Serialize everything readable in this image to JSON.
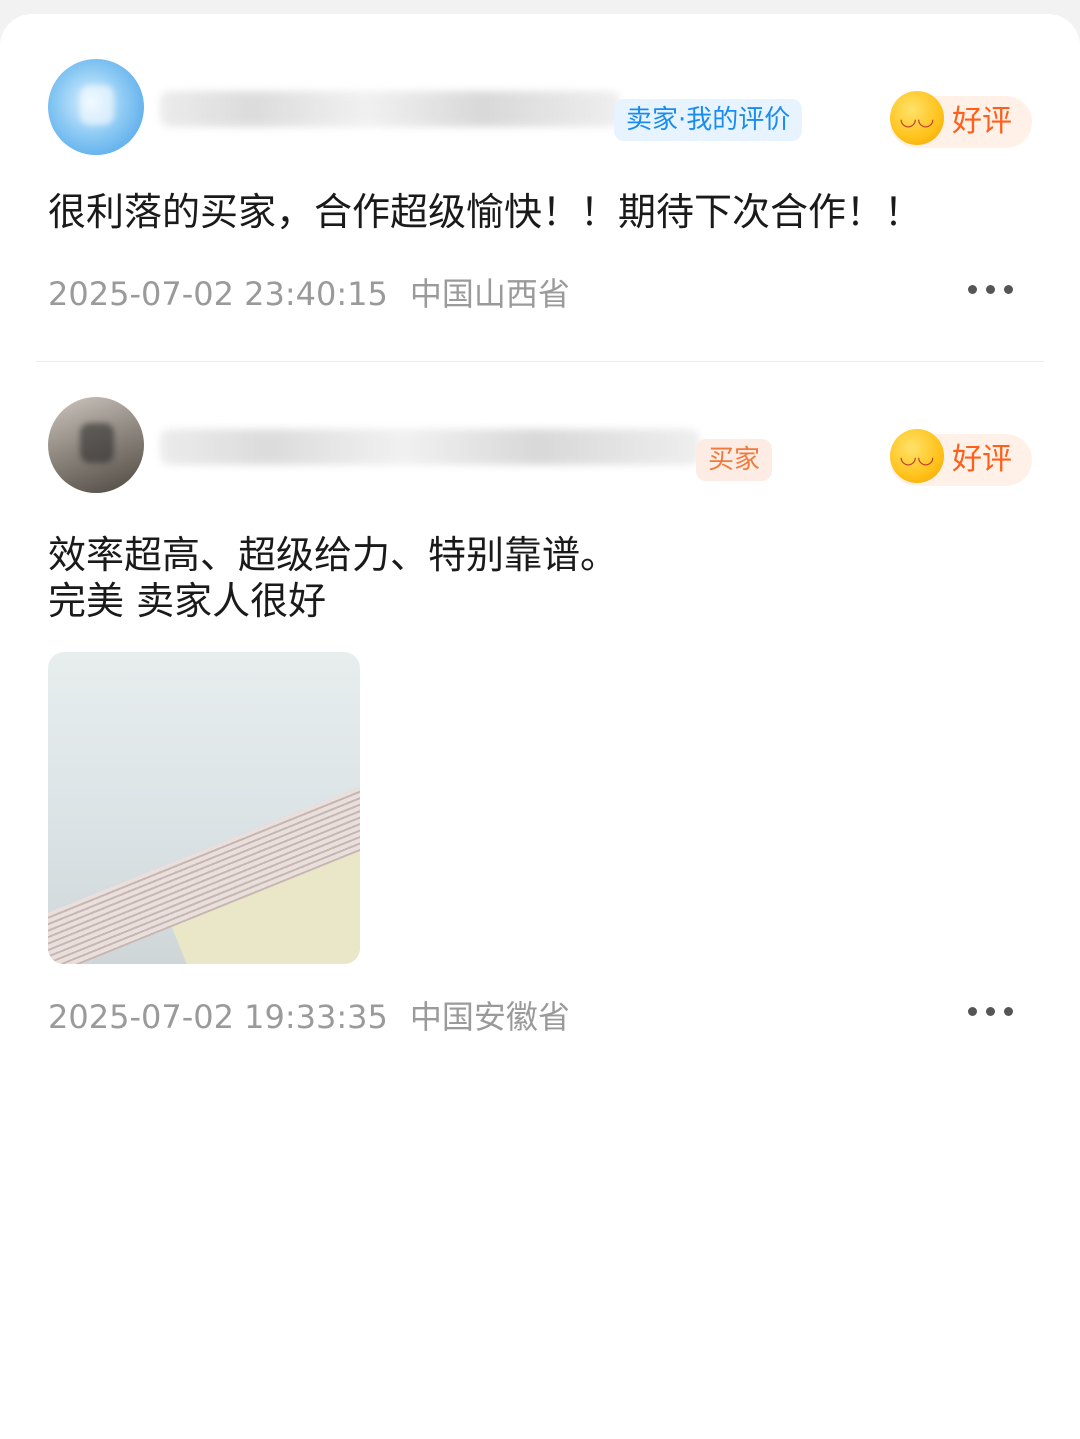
{
  "reviews": [
    {
      "role_tag": "卖家·我的评价",
      "rating": "好评",
      "content_lines": [
        "很利落的买家，合作超级愉快！！期待下次合作！！"
      ],
      "timestamp": "2025-07-02 23:40:15",
      "location": "中国山西省",
      "has_photo": false
    },
    {
      "role_tag": "买家",
      "rating": "好评",
      "content_lines": [
        "效率超高、超级给力、特别靠谱。",
        "完美 卖家人很好"
      ],
      "timestamp": "2025-07-02 19:33:35",
      "location": "中国安徽省",
      "has_photo": true
    }
  ],
  "icons": {
    "rating_emoji": "smiling-face-icon",
    "more": "more-options-icon"
  },
  "colors": {
    "seller_tag_text": "#1a8cf0",
    "buyer_tag_text": "#f07a3c",
    "rating_text": "#ff5f1a",
    "meta_text": "#9a9a9a"
  }
}
